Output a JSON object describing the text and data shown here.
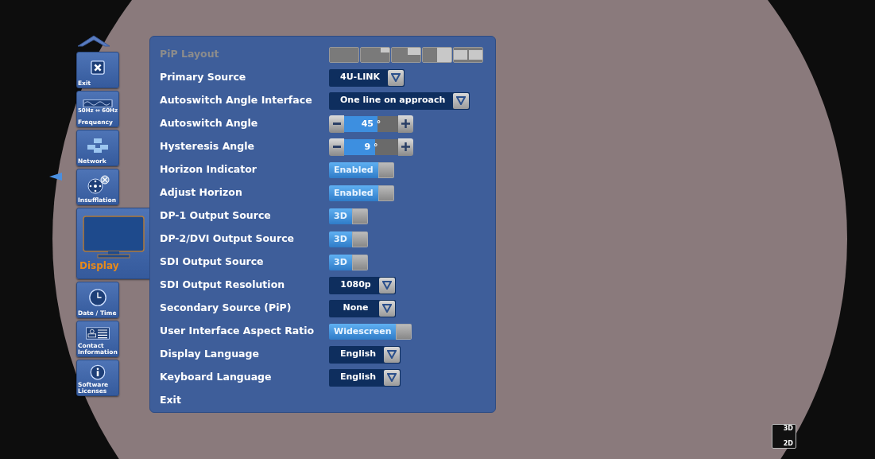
{
  "nav": {
    "items": [
      {
        "kind": "exit",
        "label": "Exit",
        "selected": false
      },
      {
        "kind": "frequency",
        "label": "Frequency",
        "sublabel": "50Hz ⇔ 60Hz",
        "selected": false
      },
      {
        "kind": "network",
        "label": "Network",
        "selected": false
      },
      {
        "kind": "insufflation",
        "label": "Insufflation",
        "selected": false
      },
      {
        "kind": "display",
        "label": "Display",
        "selected": true
      },
      {
        "kind": "clock",
        "label": "Date / Time",
        "selected": false
      },
      {
        "kind": "contact",
        "label": "Contact Information",
        "selected": false
      },
      {
        "kind": "info",
        "label": "Software Licenses",
        "selected": false
      }
    ]
  },
  "settings": {
    "rows": [
      {
        "kind": "layouts",
        "label": "PiP Layout",
        "disabled": true,
        "layouts": [
          {
            "kind": "full"
          },
          {
            "kind": "corner-small"
          },
          {
            "kind": "corner-large"
          },
          {
            "kind": "side"
          },
          {
            "kind": "split"
          }
        ]
      },
      {
        "kind": "dropdown",
        "label": "Primary Source",
        "disabled": false,
        "value": "4U-LINK"
      },
      {
        "kind": "dropdown",
        "label": "Autoswitch Angle Interface",
        "disabled": false,
        "value": "One line on approach"
      },
      {
        "kind": "stepper",
        "label": "Autoswitch Angle",
        "disabled": false,
        "value": "45 °",
        "level": 0.62
      },
      {
        "kind": "stepper",
        "label": "Hysteresis Angle",
        "disabled": false,
        "value": "9 °",
        "level": 0.58
      },
      {
        "kind": "toggle",
        "label": "Horizon Indicator",
        "disabled": false,
        "value": "Enabled",
        "on": true
      },
      {
        "kind": "toggle",
        "label": "Adjust Horizon",
        "disabled": false,
        "value": "Enabled",
        "on": true
      },
      {
        "kind": "toggle",
        "label": "DP-1 Output Source",
        "disabled": false,
        "value": "3D",
        "on": true
      },
      {
        "kind": "toggle",
        "label": "DP-2/DVI Output Source",
        "disabled": false,
        "value": "3D",
        "on": true
      },
      {
        "kind": "toggle",
        "label": "SDI Output Source",
        "disabled": false,
        "value": "3D",
        "on": true
      },
      {
        "kind": "dropdown",
        "label": "SDI Output Resolution",
        "disabled": false,
        "value": "1080p"
      },
      {
        "kind": "dropdown",
        "label": "Secondary Source (PiP)",
        "disabled": false,
        "value": "None"
      },
      {
        "kind": "toggle",
        "label": "User Interface Aspect Ratio",
        "disabled": false,
        "value": "Widescreen",
        "on": true
      },
      {
        "kind": "dropdown",
        "label": "Display Language",
        "disabled": false,
        "value": "English"
      },
      {
        "kind": "dropdown",
        "label": "Keyboard Language",
        "disabled": false,
        "value": "English"
      },
      {
        "kind": "action",
        "label": "Exit",
        "disabled": false
      }
    ]
  },
  "mode_badge": {
    "top": "3D",
    "bottom": "2D"
  }
}
